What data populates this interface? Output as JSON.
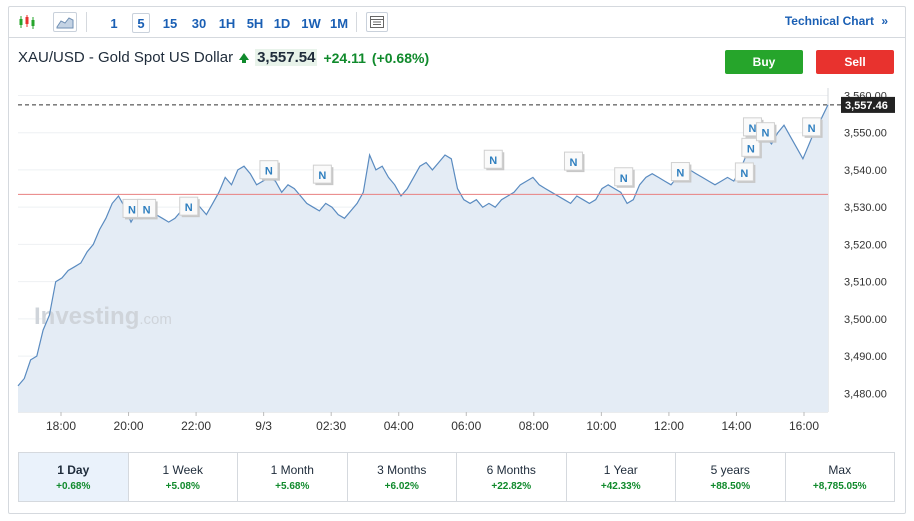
{
  "toolbar": {
    "intervals": [
      "1",
      "5",
      "15",
      "30",
      "1H",
      "5H",
      "1D",
      "1W",
      "1M"
    ],
    "active_interval": "5",
    "technical_chart_label": "Technical Chart",
    "technical_chart_chevron": "»"
  },
  "header": {
    "instrument": "XAU/USD - Gold Spot US Dollar",
    "price": "3,557.54",
    "change": "+24.11",
    "change_pct": "(+0.68%)",
    "buy_label": "Buy",
    "sell_label": "Sell"
  },
  "watermark": {
    "brand": "Investing",
    "suffix": ".com"
  },
  "colors": {
    "up": "#108a2c",
    "buy": "#26a52b",
    "sell": "#e8322e",
    "line": "#5a8bc0",
    "area": "#e4ecf5",
    "prev_close_line": "#e88080",
    "link": "#1a5fb4"
  },
  "chart_data": {
    "type": "area",
    "x_ticks": [
      "18:00",
      "20:00",
      "22:00",
      "9/3",
      "02:30",
      "04:00",
      "06:00",
      "08:00",
      "10:00",
      "12:00",
      "14:00",
      "16:00"
    ],
    "y_ticks": [
      "3,480.00",
      "3,490.00",
      "3,500.00",
      "3,510.00",
      "3,520.00",
      "3,530.00",
      "3,540.00",
      "3,550.00",
      "3,560.00"
    ],
    "ylim": [
      3475,
      3562
    ],
    "y_values": [
      3482,
      3484,
      3489,
      3490,
      3497,
      3501,
      3510,
      3511,
      3513,
      3514,
      3515,
      3518,
      3520,
      3524,
      3527,
      3531,
      3533,
      3530,
      3526,
      3529,
      3531,
      3530,
      3528,
      3527,
      3526,
      3527,
      3529,
      3531,
      3532,
      3530,
      3528,
      3531,
      3534,
      3538,
      3536,
      3540,
      3541,
      3539,
      3536,
      3537,
      3538,
      3537,
      3534,
      3536,
      3535,
      3533,
      3531,
      3530,
      3529,
      3531,
      3530,
      3528,
      3527,
      3529,
      3531,
      3534,
      3544,
      3540,
      3541,
      3538,
      3536,
      3533,
      3535,
      3538,
      3541,
      3542,
      3540,
      3542,
      3544,
      3543,
      3535,
      3532,
      3531,
      3532,
      3530,
      3531,
      3530,
      3532,
      3533,
      3534,
      3536,
      3537,
      3538,
      3536,
      3535,
      3534,
      3533,
      3532,
      3531,
      3533,
      3532,
      3531,
      3532,
      3535,
      3536,
      3535,
      3534,
      3531,
      3532,
      3536,
      3538,
      3539,
      3538,
      3537,
      3536,
      3538,
      3539,
      3540,
      3539,
      3538,
      3537,
      3536,
      3537,
      3538,
      3537,
      3540,
      3544,
      3545,
      3548,
      3549,
      3547,
      3550,
      3552,
      3549,
      3546,
      3543,
      3547,
      3551,
      3554,
      3557.5
    ],
    "current_price_label": "3,557.46",
    "current_price": 3557.46,
    "prev_close": 3533.43,
    "news_marker_label": "N",
    "news_markers": [
      {
        "t": 0.142,
        "v": 3529.4
      },
      {
        "t": 0.16,
        "v": 3529.4
      },
      {
        "t": 0.212,
        "v": 3530.0
      },
      {
        "t": 0.311,
        "v": 3539.8
      },
      {
        "t": 0.377,
        "v": 3538.6
      },
      {
        "t": 0.588,
        "v": 3542.6
      },
      {
        "t": 0.687,
        "v": 3542.1
      },
      {
        "t": 0.749,
        "v": 3537.9
      },
      {
        "t": 0.819,
        "v": 3539.3
      },
      {
        "t": 0.898,
        "v": 3539.2
      },
      {
        "t": 0.906,
        "v": 3545.8
      },
      {
        "t": 0.908,
        "v": 3551.3
      },
      {
        "t": 0.924,
        "v": 3550.0
      },
      {
        "t": 0.981,
        "v": 3551.3
      }
    ]
  },
  "periods": [
    {
      "label": "1 Day",
      "value": "+0.68%"
    },
    {
      "label": "1 Week",
      "value": "+5.08%"
    },
    {
      "label": "1 Month",
      "value": "+5.68%"
    },
    {
      "label": "3 Months",
      "value": "+6.02%"
    },
    {
      "label": "6 Months",
      "value": "+22.82%"
    },
    {
      "label": "1 Year",
      "value": "+42.33%"
    },
    {
      "label": "5 years",
      "value": "+88.50%"
    },
    {
      "label": "Max",
      "value": "+8,785.05%"
    }
  ],
  "active_period": "1 Day"
}
